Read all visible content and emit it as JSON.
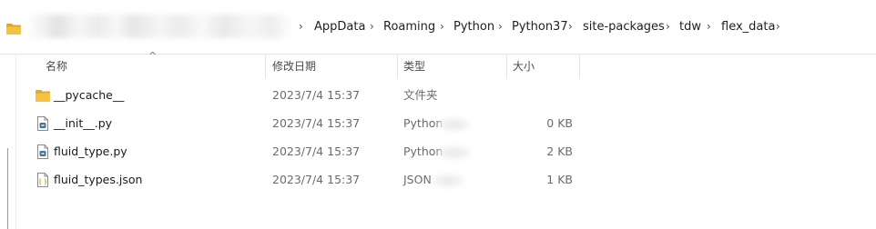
{
  "address_bar": {
    "crumbs": [
      "AppData",
      "Roaming",
      "Python",
      "Python37",
      "site-packages",
      "tdw",
      "flex_data"
    ],
    "separator": "›"
  },
  "columns": {
    "name": "名称",
    "date_modified": "修改日期",
    "type": "类型",
    "size": "大小",
    "sort_indicator": "^"
  },
  "files": [
    {
      "name": "__pycache__",
      "date": "2023/7/4 15:37",
      "type": "文件夹",
      "size": "",
      "icon": "folder-icon"
    },
    {
      "name": "__init__.py",
      "date": "2023/7/4 15:37",
      "type": "Python",
      "size": "0 KB",
      "icon": "python-file-icon"
    },
    {
      "name": "fluid_type.py",
      "date": "2023/7/4 15:37",
      "type": "Python",
      "size": "2 KB",
      "icon": "python-file-icon"
    },
    {
      "name": "fluid_types.json",
      "date": "2023/7/4 15:37",
      "type": "JSON",
      "size": "1 KB",
      "icon": "json-file-icon"
    }
  ],
  "colors": {
    "folder": "#f5c242",
    "folder_dark": "#e0a92a",
    "python_blue": "#3b74b8",
    "header_text": "#4a4a4a",
    "meta_text": "#6b6b6b"
  }
}
